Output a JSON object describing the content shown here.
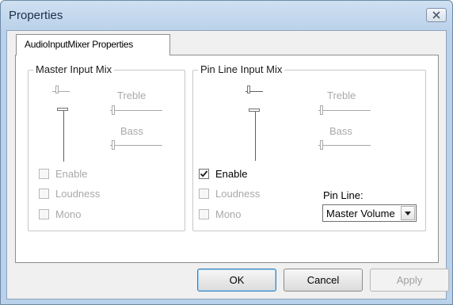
{
  "window": {
    "title": "Properties"
  },
  "tabs": [
    {
      "label": "AudioInputMixer Properties"
    }
  ],
  "master": {
    "label": "Master Input Mix",
    "treble_label": "Treble",
    "bass_label": "Bass",
    "enable_label": "Enable",
    "loudness_label": "Loudness",
    "mono_label": "Mono",
    "enable_checked": false
  },
  "pin": {
    "label": "Pin Line Input Mix",
    "treble_label": "Treble",
    "bass_label": "Bass",
    "enable_label": "Enable",
    "loudness_label": "Loudness",
    "mono_label": "Mono",
    "enable_checked": true,
    "pinline_label": "Pin Line:",
    "pinline_value": "Master Volume"
  },
  "buttons": {
    "ok": "OK",
    "cancel": "Cancel",
    "apply": "Apply"
  }
}
